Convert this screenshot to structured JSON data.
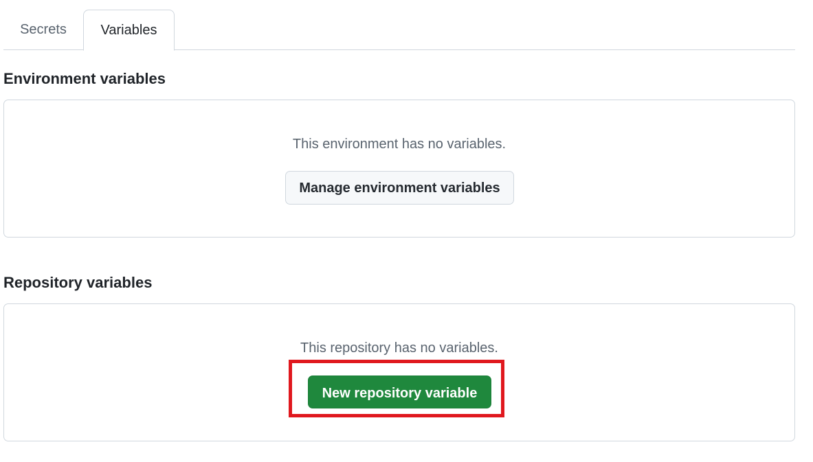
{
  "tabs": {
    "secrets_label": "Secrets",
    "variables_label": "Variables",
    "active": "Variables"
  },
  "environment": {
    "title": "Environment variables",
    "empty_text": "This environment has no variables.",
    "manage_button_label": "Manage environment variables"
  },
  "repository": {
    "title": "Repository variables",
    "empty_text": "This repository has no variables.",
    "new_button_label": "New repository variable"
  },
  "colors": {
    "primary_button": "#1f883d",
    "highlight_border": "#e0181e",
    "border": "#d0d7de"
  }
}
